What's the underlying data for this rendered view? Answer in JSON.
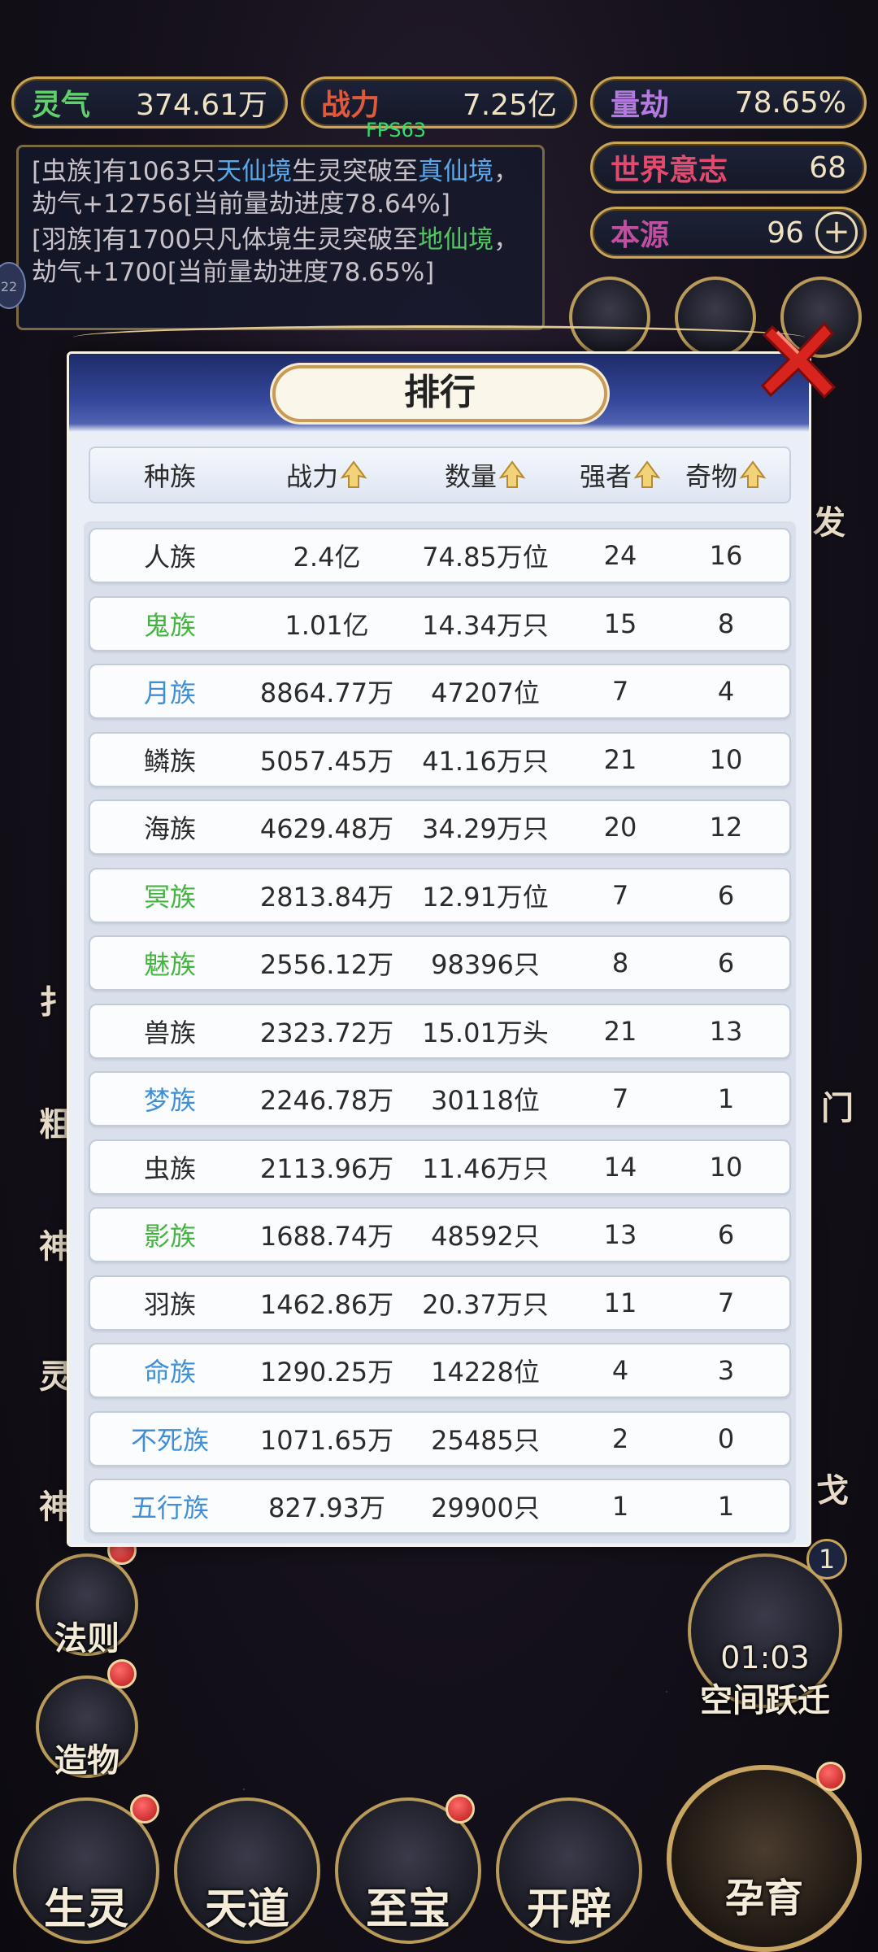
{
  "hud": {
    "lingqi": {
      "label": "灵气",
      "value": "374.61万"
    },
    "zhanli": {
      "label": "战力",
      "value": "7.25亿"
    },
    "liangjie": {
      "label": "量劫",
      "value": "78.65%"
    },
    "shijie": {
      "label": "世界意志",
      "value": "68"
    },
    "benyuan": {
      "label": "本源",
      "value": "96"
    },
    "fps": "FPS63"
  },
  "log": [
    {
      "p1": "[虫族]有1063只",
      "realm1": "天仙境",
      "p2": "生灵突破至",
      "realm2": "真仙境",
      "p3": "，劫气+12756[当前量劫进度78.64%]"
    },
    {
      "p1": "[羽族]有1700只凡体境生灵突破至",
      "realm2": "地仙境",
      "p3": "，劫气+1700[当前量劫进度78.65%]"
    }
  ],
  "background_buttons": {
    "fa_ze": "法则",
    "zao_wu": "造物",
    "timer": "01:03",
    "space_jump": "空间跃迁",
    "space_jump_count": "1",
    "bottom_nav": [
      "生灵",
      "天道",
      "至宝",
      "开辟"
    ],
    "yun_yu": "孕育",
    "side_right": [
      "发",
      "门",
      "戈"
    ],
    "side_left": [
      "扌",
      "粗",
      "神",
      "灵",
      "神"
    ]
  },
  "panel": {
    "title": "排行",
    "columns": [
      "种族",
      "战力",
      "数量",
      "强者",
      "奇物"
    ],
    "rows": [
      {
        "race": "人族",
        "power": "2.4亿",
        "count": "74.85万位",
        "strong": "24",
        "treasure": "16",
        "color": "black"
      },
      {
        "race": "鬼族",
        "power": "1.01亿",
        "count": "14.34万只",
        "strong": "15",
        "treasure": "8",
        "color": "green"
      },
      {
        "race": "月族",
        "power": "8864.77万",
        "count": "47207位",
        "strong": "7",
        "treasure": "4",
        "color": "blue"
      },
      {
        "race": "鳞族",
        "power": "5057.45万",
        "count": "41.16万只",
        "strong": "21",
        "treasure": "10",
        "color": "black"
      },
      {
        "race": "海族",
        "power": "4629.48万",
        "count": "34.29万只",
        "strong": "20",
        "treasure": "12",
        "color": "black"
      },
      {
        "race": "冥族",
        "power": "2813.84万",
        "count": "12.91万位",
        "strong": "7",
        "treasure": "6",
        "color": "green"
      },
      {
        "race": "魅族",
        "power": "2556.12万",
        "count": "98396只",
        "strong": "8",
        "treasure": "6",
        "color": "green"
      },
      {
        "race": "兽族",
        "power": "2323.72万",
        "count": "15.01万头",
        "strong": "21",
        "treasure": "13",
        "color": "black"
      },
      {
        "race": "梦族",
        "power": "2246.78万",
        "count": "30118位",
        "strong": "7",
        "treasure": "1",
        "color": "blue"
      },
      {
        "race": "虫族",
        "power": "2113.96万",
        "count": "11.46万只",
        "strong": "14",
        "treasure": "10",
        "color": "black"
      },
      {
        "race": "影族",
        "power": "1688.74万",
        "count": "48592只",
        "strong": "13",
        "treasure": "6",
        "color": "green"
      },
      {
        "race": "羽族",
        "power": "1462.86万",
        "count": "20.37万只",
        "strong": "11",
        "treasure": "7",
        "color": "black"
      },
      {
        "race": "命族",
        "power": "1290.25万",
        "count": "14228位",
        "strong": "4",
        "treasure": "3",
        "color": "blue"
      },
      {
        "race": "不死族",
        "power": "1071.65万",
        "count": "25485只",
        "strong": "2",
        "treasure": "0",
        "color": "blue"
      },
      {
        "race": "五行族",
        "power": "827.93万",
        "count": "29900只",
        "strong": "1",
        "treasure": "1",
        "color": "blue"
      }
    ]
  },
  "colors": {
    "green_race": "#43b43e",
    "blue_race": "#3f8fd6",
    "panel_bg": "#e9eef7",
    "gold": "#c9a55a"
  }
}
